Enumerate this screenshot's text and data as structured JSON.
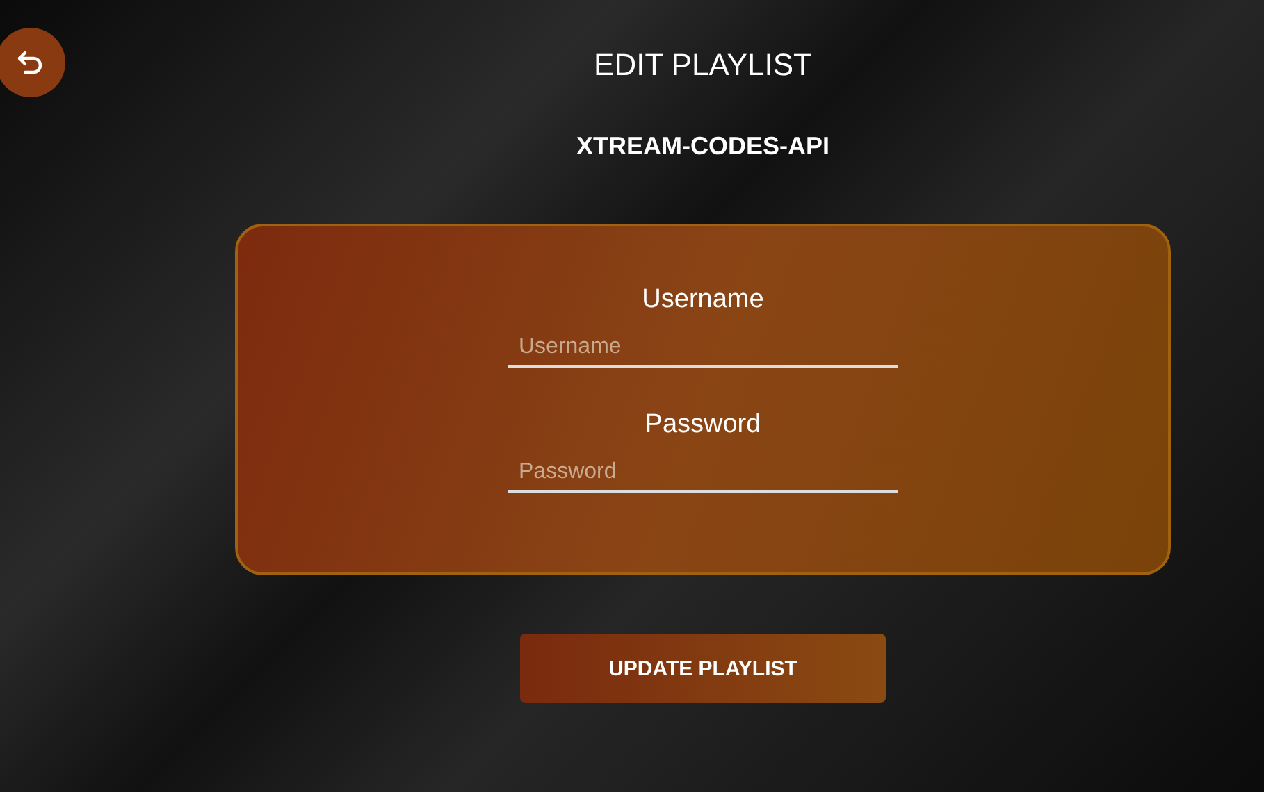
{
  "header": {
    "title": "EDIT PLAYLIST",
    "subtitle": "XTREAM-CODES-API"
  },
  "form": {
    "fields": [
      {
        "label": "Username",
        "placeholder": "Username"
      },
      {
        "label": "Password",
        "placeholder": "Password"
      }
    ]
  },
  "button": {
    "label": "UPDATE PLAYLIST"
  }
}
